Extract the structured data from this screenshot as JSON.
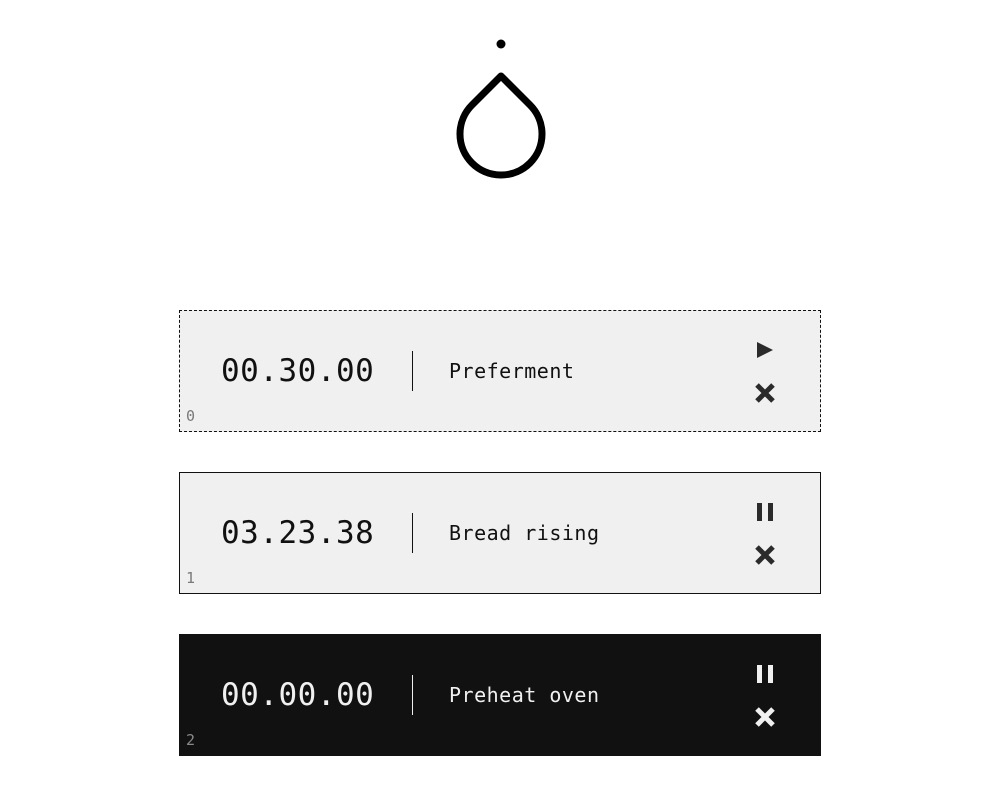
{
  "app": {
    "logo_icon": "droplet-icon"
  },
  "timers": [
    {
      "index": "0",
      "time": "00.30.00",
      "label": "Preferment",
      "state": "stopped",
      "style": "selected",
      "primary_action_icon": "play-icon",
      "secondary_action_icon": "close-icon"
    },
    {
      "index": "1",
      "time": "03.23.38",
      "label": "Bread rising",
      "state": "running",
      "style": "normal",
      "primary_action_icon": "pause-icon",
      "secondary_action_icon": "close-icon"
    },
    {
      "index": "2",
      "time": "00.00.00",
      "label": "Preheat oven",
      "state": "finished",
      "style": "inverted",
      "primary_action_icon": "pause-icon",
      "secondary_action_icon": "close-icon"
    }
  ],
  "colors": {
    "background": "#ffffff",
    "card_light": "#f0f0f0",
    "card_dark": "#111111",
    "text_dark": "#111111",
    "text_light": "#f0f0f0",
    "index_text": "#7a7a7a"
  }
}
